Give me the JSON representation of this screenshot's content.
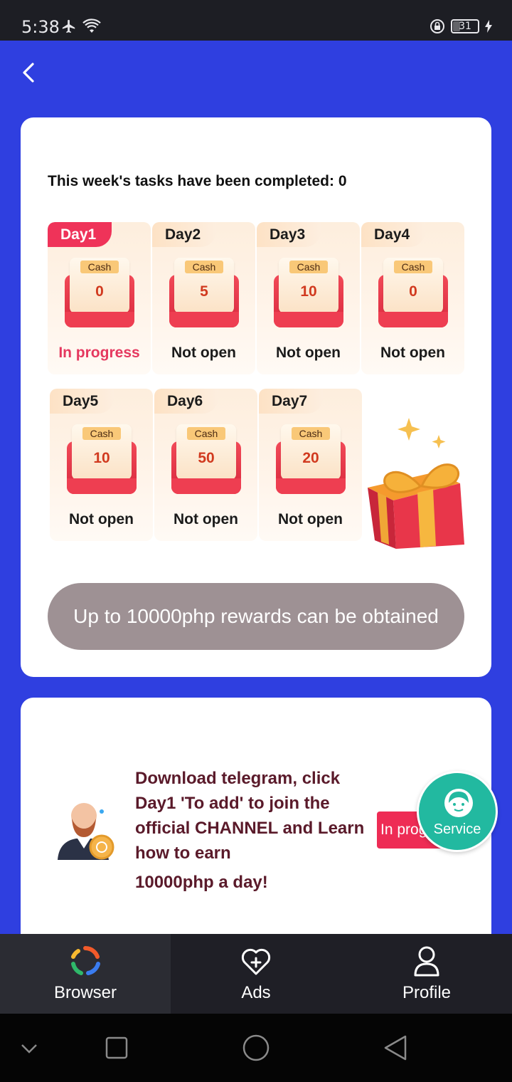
{
  "status_bar": {
    "time": "5:38",
    "battery": "31"
  },
  "task_card": {
    "week_status": "This week's tasks have been completed: 0",
    "chest_label": "Cash",
    "days": [
      {
        "day": "Day1",
        "value": "0",
        "status": "In progress",
        "active": true
      },
      {
        "day": "Day2",
        "value": "5",
        "status": "Not open",
        "active": false
      },
      {
        "day": "Day3",
        "value": "10",
        "status": "Not open",
        "active": false
      },
      {
        "day": "Day4",
        "value": "0",
        "status": "Not open",
        "active": false
      },
      {
        "day": "Day5",
        "value": "10",
        "status": "Not open",
        "active": false
      },
      {
        "day": "Day6",
        "value": "50",
        "status": "Not open",
        "active": false
      },
      {
        "day": "Day7",
        "value": "20",
        "status": "Not open",
        "active": false
      }
    ],
    "reward_button": "Up to 10000php rewards can be obtained"
  },
  "telegram_card": {
    "text": "Download telegram, click Day1 'To add' to join the official CHANNEL and Learn how to earn",
    "text_last": "10000php a day!",
    "button": "In progress"
  },
  "service": {
    "label": "Service"
  },
  "tab_bar": {
    "tabs": [
      {
        "label": "Browser",
        "active": true
      },
      {
        "label": "Ads",
        "active": false
      },
      {
        "label": "Profile",
        "active": false
      }
    ]
  },
  "colors": {
    "header_blue": "#2f3fe0",
    "accent_red": "#ef3359",
    "service_teal": "#22b9a0",
    "pill_gray": "#9e9194"
  }
}
